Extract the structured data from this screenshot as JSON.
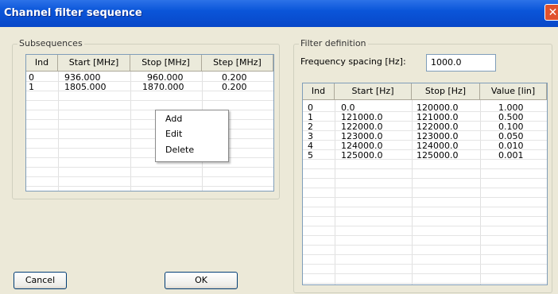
{
  "window": {
    "title": "Channel filter sequence"
  },
  "subsequences": {
    "label": "Subsequences",
    "columns": [
      "Ind",
      "Start [MHz]",
      "Stop [MHz]",
      "Step [MHz]"
    ],
    "rows": [
      [
        "0",
        "936.000",
        "960.000",
        "0.200"
      ],
      [
        "1",
        "1805.000",
        "1870.000",
        "0.200"
      ]
    ]
  },
  "context_menu": {
    "items": [
      "Add",
      "Edit",
      "Delete"
    ]
  },
  "filter_definition": {
    "label": "Filter definition",
    "spacing_label": "Frequency spacing [Hz]:",
    "spacing_value": "1000.0",
    "columns": [
      "Ind",
      "Start [Hz]",
      "Stop [Hz]",
      "Value [lin]"
    ],
    "rows": [
      [
        "0",
        "0.0",
        "120000.0",
        "1.000"
      ],
      [
        "1",
        "121000.0",
        "121000.0",
        "0.500"
      ],
      [
        "2",
        "122000.0",
        "122000.0",
        "0.100"
      ],
      [
        "3",
        "123000.0",
        "123000.0",
        "0.050"
      ],
      [
        "4",
        "124000.0",
        "124000.0",
        "0.010"
      ],
      [
        "5",
        "125000.0",
        "125000.0",
        "0.001"
      ]
    ]
  },
  "buttons": {
    "cancel": "Cancel",
    "ok": "OK"
  },
  "colors": {
    "titlebar": "#0A55D9",
    "close": "#E0522D",
    "dialog_bg": "#ECE9D8"
  }
}
